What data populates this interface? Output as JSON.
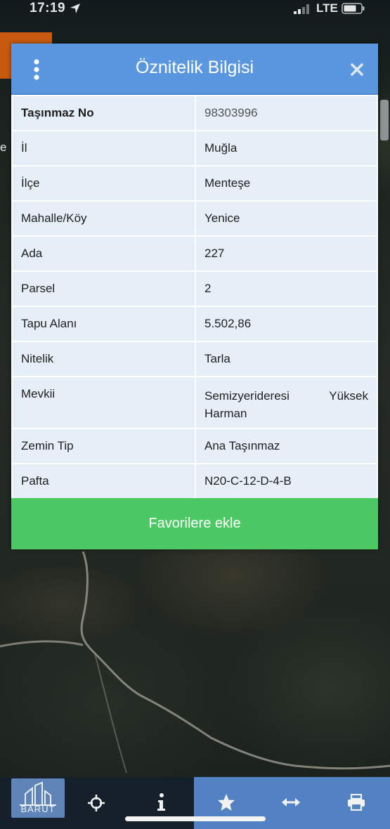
{
  "status_bar": {
    "time": "17:19",
    "network": "LTE"
  },
  "map": {
    "edge_text": "e"
  },
  "modal": {
    "title": "Öznitelik Bilgisi",
    "rows": [
      {
        "key": "Taşınmaz No",
        "value": "98303996"
      },
      {
        "key": "İl",
        "value": "Muğla"
      },
      {
        "key": "İlçe",
        "value": "Menteşe"
      },
      {
        "key": "Mahalle/Köy",
        "value": "Yenice"
      },
      {
        "key": "Ada",
        "value": "227"
      },
      {
        "key": "Parsel",
        "value": "2"
      },
      {
        "key": "Tapu Alanı",
        "value": "5.502,86"
      },
      {
        "key": "Nitelik",
        "value": "Tarla"
      },
      {
        "key": "Mevkii",
        "value": "Semizyerideresi Yüksek Harman"
      },
      {
        "key": "Zemin Tip",
        "value": "Ana Taşınmaz"
      },
      {
        "key": "Pafta",
        "value": "N20-C-12-D-4-B"
      }
    ],
    "favorite_button_label": "Favorilere ekle"
  },
  "bottom_bar": {
    "logo_text": "BARUT",
    "tools": [
      "crosshair-icon",
      "info-icon",
      "star-icon",
      "arrows-horizontal-icon",
      "printer-icon"
    ]
  },
  "colors": {
    "header": "#5b97de",
    "row_background": "#e6eff8",
    "favorite_button": "#4cc865",
    "toolbar": "#5282c4",
    "orange_tab": "#c85a10"
  }
}
